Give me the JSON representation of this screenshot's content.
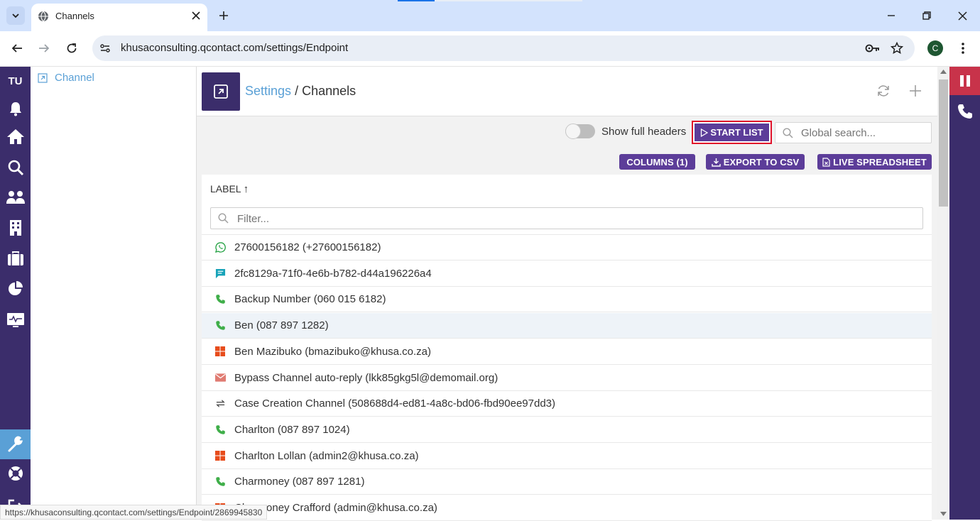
{
  "browser": {
    "tab_title": "Channels",
    "url": "khusaconsulting.qcontact.com/settings/Endpoint",
    "profile_initial": "C",
    "status_url": "https://khusaconsulting.qcontact.com/settings/Endpoint/2869945830"
  },
  "leftnav": {
    "user_initials": "TU",
    "items": [
      "bell-icon",
      "home-icon",
      "search-icon",
      "contacts-icon",
      "building-icon",
      "briefcase-icon",
      "pie-chart-icon",
      "monitor-icon",
      "wrench-icon",
      "help-icon",
      "logout-icon"
    ]
  },
  "tree": {
    "items": [
      {
        "label": "Channel"
      }
    ]
  },
  "header": {
    "breadcrumb_root": "Settings",
    "breadcrumb_sep": "/",
    "breadcrumb_current": "Channels"
  },
  "controls": {
    "show_full_headers_label": "Show full headers",
    "show_full_headers_on": false,
    "start_list_label": "START LIST",
    "search_placeholder": "Global search...",
    "columns_label": "COLUMNS (1)",
    "export_label": "EXPORT TO CSV",
    "live_spreadsheet_label": "LIVE SPREADSHEET"
  },
  "list": {
    "column_header": "LABEL",
    "sort_indicator": "↑",
    "filter_placeholder": "Filter...",
    "rows": [
      {
        "icon": "whatsapp-icon",
        "label": "27600156182 (+27600156182)",
        "highlighted": false
      },
      {
        "icon": "chat-icon",
        "label": "2fc8129a-71f0-4e6b-b782-d44a196226a4",
        "highlighted": false
      },
      {
        "icon": "phone-icon",
        "label": "Backup Number (060 015 6182)",
        "highlighted": false
      },
      {
        "icon": "phone-icon",
        "label": "Ben (087 897 1282)",
        "highlighted": true
      },
      {
        "icon": "microsoft-icon",
        "label": "Ben Mazibuko (bmazibuko@khusa.co.za)",
        "highlighted": false
      },
      {
        "icon": "email-icon",
        "label": "Bypass Channel auto-reply (lkk85gkg5l@demomail.org)",
        "highlighted": false
      },
      {
        "icon": "sync-icon",
        "label": "Case Creation Channel (508688d4-ed81-4a8c-bd06-fbd90ee97dd3)",
        "highlighted": false
      },
      {
        "icon": "phone-icon",
        "label": "Charlton (087 897 1024)",
        "highlighted": false
      },
      {
        "icon": "microsoft-icon",
        "label": "Charlton Lollan (admin2@khusa.co.za)",
        "highlighted": false
      },
      {
        "icon": "phone-icon",
        "label": "Charmoney (087 897 1281)",
        "highlighted": false
      },
      {
        "icon": "microsoft-icon",
        "label": "Charmoney Crafford (admin@khusa.co.za)",
        "highlighted": false
      }
    ]
  },
  "colors": {
    "nav_bg": "#3b2d6b",
    "accent": "#5c3d99",
    "link": "#5aa0d6",
    "highlight_row": "#eef3f8",
    "alert_red": "#c8334a"
  }
}
